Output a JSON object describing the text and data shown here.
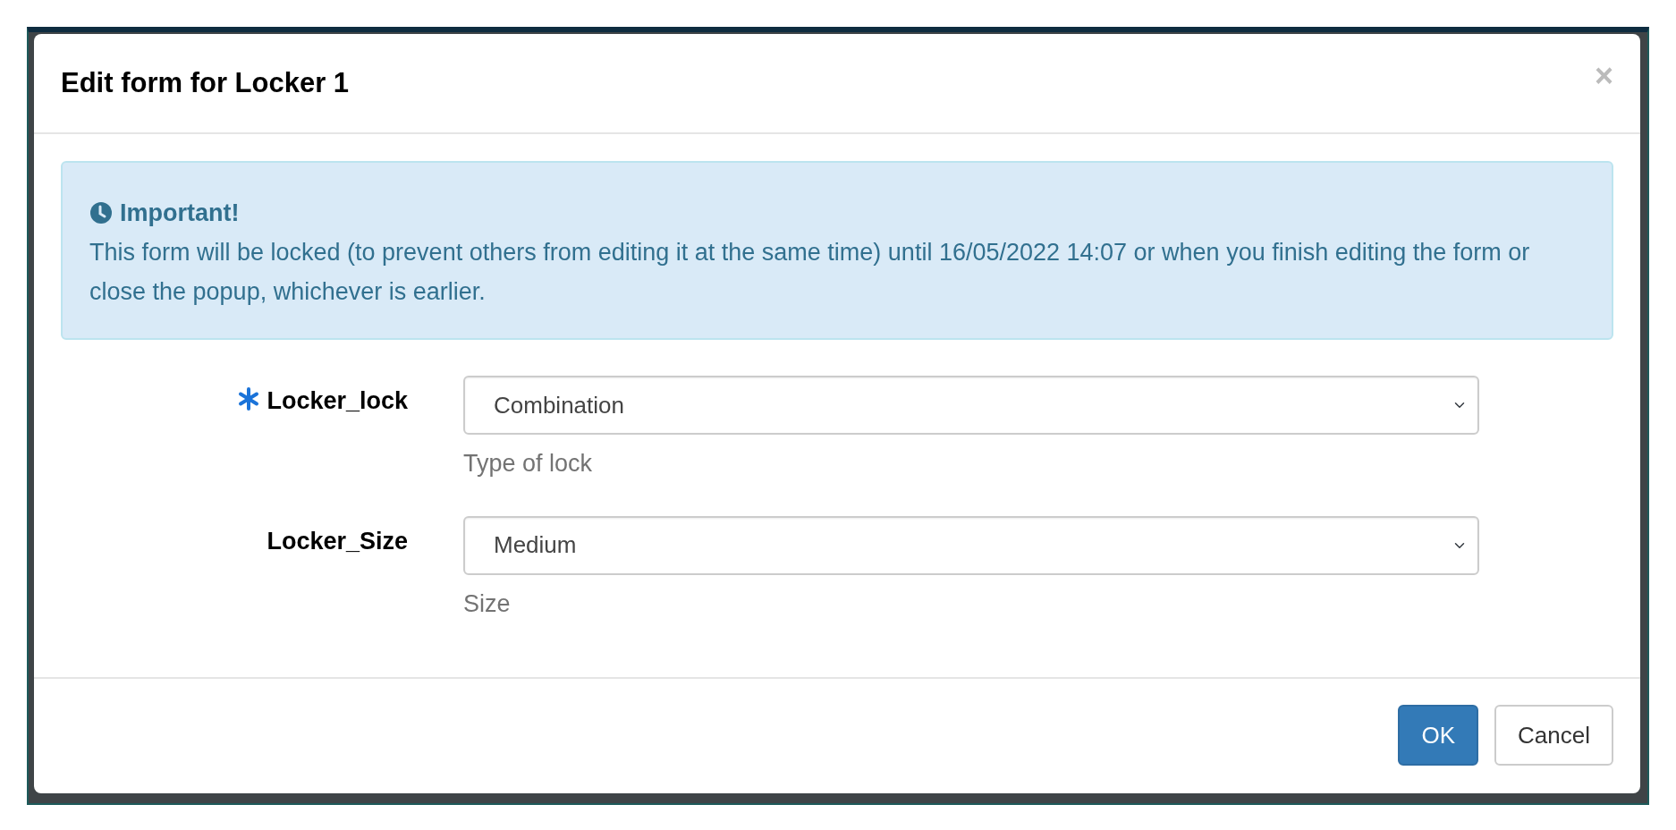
{
  "modal": {
    "title": "Edit form for Locker 1",
    "close": "×"
  },
  "alert": {
    "heading": "Important!",
    "text": "This form will be locked (to prevent others from editing it at the same time) until 16/05/2022 14:07 or when you finish editing the form or close the popup, whichever is earlier."
  },
  "fields": [
    {
      "label": "Locker_lock",
      "required": true,
      "value": "Combination",
      "help": "Type of lock"
    },
    {
      "label": "Locker_Size",
      "required": false,
      "value": "Medium",
      "help": "Size"
    }
  ],
  "buttons": [
    {
      "label": "OK",
      "kind": "primary"
    },
    {
      "label": "Cancel",
      "kind": "secondary"
    }
  ]
}
